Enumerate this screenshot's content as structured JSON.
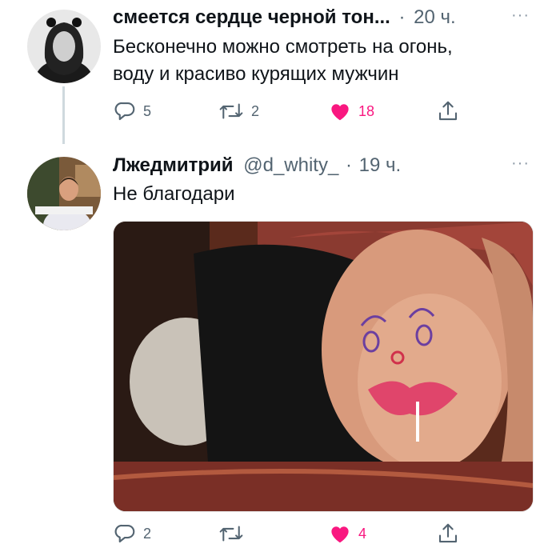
{
  "tweets": [
    {
      "name": "смеется сердце черной тон...",
      "handle": "",
      "dot": "·",
      "time": "20 ч.",
      "more": "···",
      "text_lines": [
        "Бесконечно можно смотреть на огонь,",
        "воду и красиво курящих мужчин"
      ],
      "replies": "5",
      "retweets": "2",
      "likes": "18",
      "liked": true
    },
    {
      "name": "Лжедмитрий",
      "handle": "@d_whity_",
      "dot": "·",
      "time": "19 ч.",
      "more": "···",
      "text_lines": [
        "Не благодари"
      ],
      "replies": "2",
      "retweets": "",
      "likes": "4",
      "liked": true,
      "has_media": true
    }
  ],
  "colors": {
    "text": "#0f1419",
    "secondary": "#536471",
    "like": "#f91880",
    "thread_line": "#cfd9de"
  },
  "icons": [
    "reply-icon",
    "retweet-icon",
    "heart-icon",
    "share-icon",
    "more-icon"
  ]
}
